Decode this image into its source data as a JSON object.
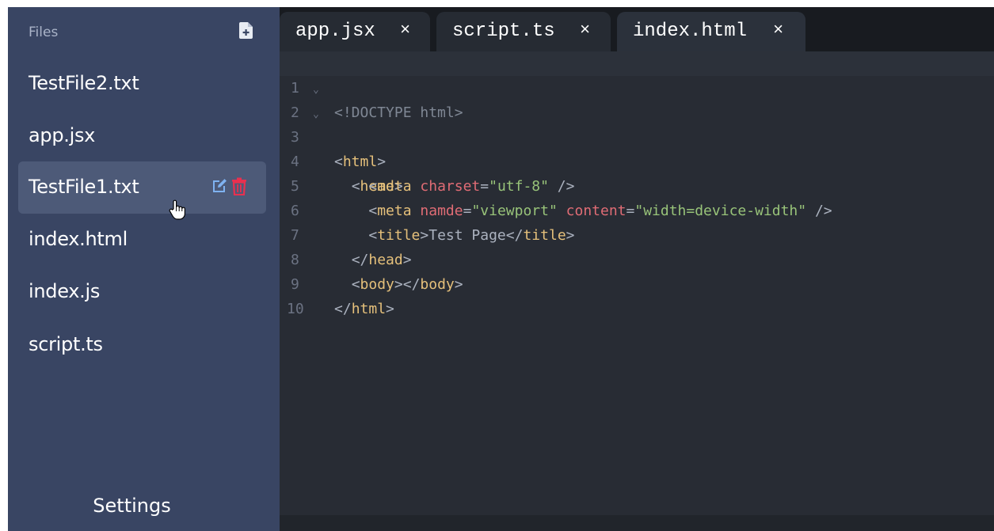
{
  "sidebar": {
    "title": "Files",
    "new_file_icon": "file-plus-icon",
    "files": [
      {
        "label": "TestFile2.txt"
      },
      {
        "label": "app.jsx"
      },
      {
        "label": "TestFile1.txt",
        "hovered": true
      },
      {
        "label": "index.html"
      },
      {
        "label": "index.js"
      },
      {
        "label": "script.ts"
      }
    ],
    "hover_actions": {
      "edit_icon": "edit-icon",
      "delete_icon": "trash-icon"
    },
    "settings_label": "Settings"
  },
  "tabs": [
    {
      "label": "app.jsx",
      "close": "×"
    },
    {
      "label": "script.ts",
      "close": "×"
    },
    {
      "label": "index.html",
      "close": "×",
      "active": true
    }
  ],
  "editor": {
    "line_numbers": [
      "1",
      "2",
      "3",
      "4",
      "5",
      "6",
      "7",
      "8",
      "9",
      "10"
    ],
    "fold_marker": "⌄",
    "lines": {
      "l1": {
        "doctype": "<!DOCTYPE html>"
      },
      "l2": {
        "open": "<",
        "tag": "html",
        "close": ">"
      },
      "l3": {
        "indent": "  ",
        "open": "<",
        "tag": "head",
        "close": ">"
      },
      "l4": {
        "indent": "    ",
        "open": "<",
        "tag": "meta",
        "sp": " ",
        "attr1": "charset",
        "eq1": "=",
        "val1": "\"utf-8\"",
        "end": " />"
      },
      "l5": {
        "indent": "    ",
        "open": "<",
        "tag": "meta",
        "sp": " ",
        "attr1": "namde",
        "eq1": "=",
        "val1": "\"viewport\"",
        "sp2": " ",
        "attr2": "content",
        "eq2": "=",
        "val2": "\"width=device-width\"",
        "end": " />"
      },
      "l6": {
        "indent": "    ",
        "open": "<",
        "tag": "title",
        "close": ">",
        "text": "Test Page",
        "open2": "</",
        "tag2": "title",
        "close2": ">"
      },
      "l7": {
        "indent": "  ",
        "open": "</",
        "tag": "head",
        "close": ">"
      },
      "l8": {
        "indent": "  ",
        "open": "<",
        "tag": "body",
        "close": "></",
        "tag2": "body",
        "close2": ">"
      },
      "l9": {
        "open": "</",
        "tag": "html",
        "close": ">"
      }
    }
  },
  "colors": {
    "sidebar_bg": "#394563",
    "sidebar_hover": "#4d5a78",
    "editor_bg": "#282c34",
    "tabbar_bg": "#181b20",
    "tag": "#e5c07b",
    "attribute": "#e06c75",
    "string": "#98c379",
    "edit_icon": "#7fb2f0",
    "trash_icon": "#e8304f"
  }
}
